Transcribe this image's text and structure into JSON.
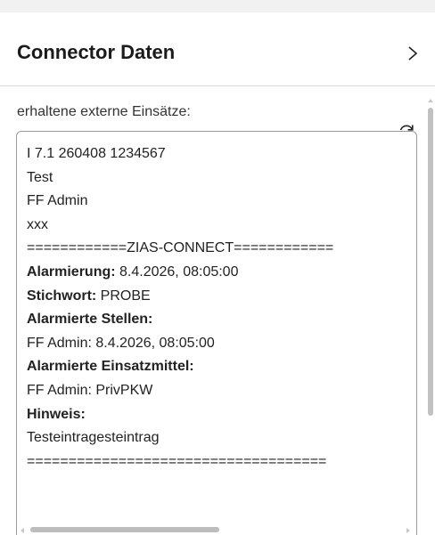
{
  "panel": {
    "title": "Connector Daten",
    "section_label": "erhaltene externe Einsätze:"
  },
  "icons": {
    "expand": "chevron-right-icon",
    "refresh": "refresh-icon"
  },
  "incident_text": {
    "line1": "I 7.1 260408 1234567",
    "line2": "Test",
    "line3": "FF Admin",
    "line4": "xxx",
    "line5": "============ZIAS-CONNECT============",
    "alarmierung_label": "Alarmierung:",
    "alarmierung_value": " 8.4.2026, 08:05:00",
    "stichwort_label": "Stichwort:",
    "stichwort_value": " PROBE",
    "stellen_label": "Alarmierte Stellen:",
    "stellen_value": "FF Admin: 8.4.2026, 08:05:00",
    "einsatzmittel_label": "Alarmierte Einsatzmittel:",
    "einsatzmittel_value": "FF Admin: PrivPKW",
    "hinweis_label": "Hinweis:",
    "hinweis_value": "Testeintragesteintrag",
    "footer_line": "===================================="
  }
}
